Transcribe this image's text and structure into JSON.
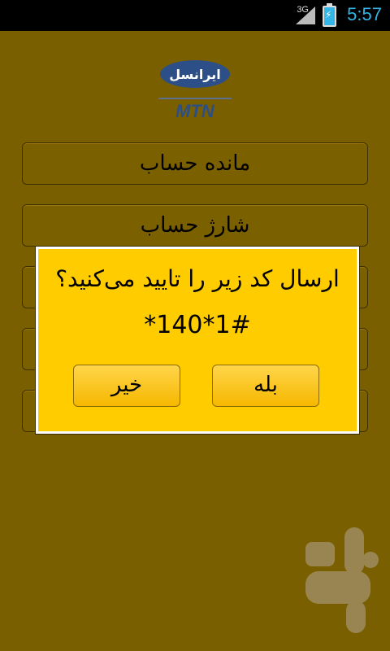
{
  "status_bar": {
    "network": "3G",
    "time": "5:57"
  },
  "logo": {
    "brand_fa": "ایرانسل",
    "brand_en": "MTN"
  },
  "menu": {
    "items": [
      {
        "label": "مانده حساب"
      },
      {
        "label": "شارژ حساب"
      },
      {
        "label": ""
      },
      {
        "label": ""
      },
      {
        "label": ""
      }
    ]
  },
  "dialog": {
    "message": "ارسال کد زیر را تایید می‌کنید؟",
    "code": "*140*1#",
    "yes_label": "بله",
    "no_label": "خیر"
  },
  "colors": {
    "background": "#7a5f00",
    "dialog": "#ffcc00",
    "accent": "#33b5e5"
  }
}
